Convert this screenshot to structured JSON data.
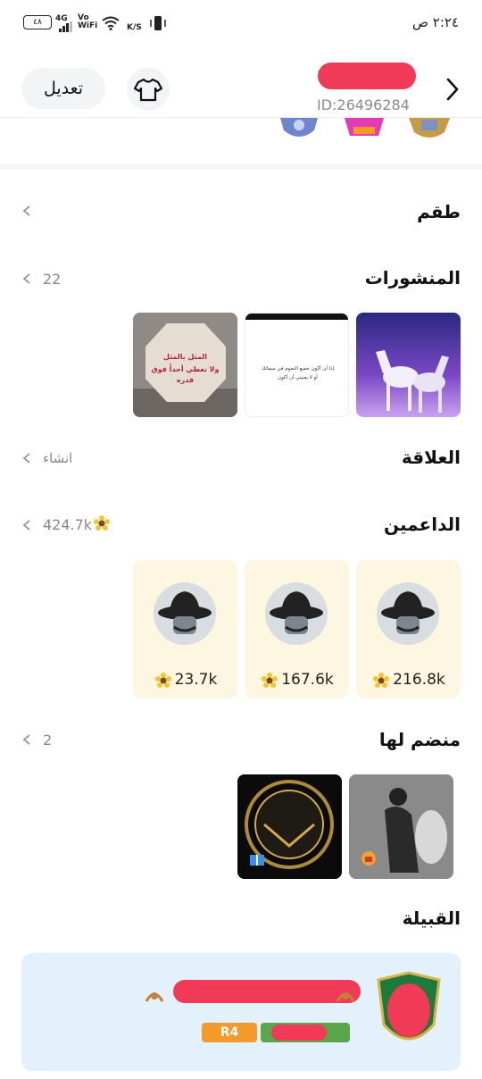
{
  "status_bar": {
    "time": "٢:٢٤ ص",
    "battery": "٤٨",
    "network": "4G",
    "vowifi": "Vo WiFi",
    "speed": "K/S"
  },
  "header": {
    "edit_label": "تعديل",
    "user_id": "ID:26496284"
  },
  "sections": {
    "outfit": {
      "title": "طقم"
    },
    "posts": {
      "title": "المنشورات",
      "count": "22"
    },
    "relationship": {
      "title": "العلاقة",
      "action": "انشاء"
    },
    "supporters": {
      "title": "الداعمين",
      "total": "424.7k",
      "items": [
        {
          "value": "216.8k"
        },
        {
          "value": "167.6k"
        },
        {
          "value": "23.7k"
        }
      ]
    },
    "joined": {
      "title": "منضم لها",
      "count": "2"
    },
    "clan": {
      "title": "القبيلة",
      "rank": "R4"
    }
  },
  "post_texts": {
    "quote_line1": "إذا أن أكون جميع النجوم في سمائك",
    "quote_line2": "أو لا يعنيني أن أكون",
    "sign_line1": "المثل بالمثل",
    "sign_line2": "ولا نعطي أحداً فوق قدره"
  },
  "colors": {
    "accent_gold": "#f3c62e",
    "card_bg": "#fdf6e1",
    "clan_bg": "#e2f1fb",
    "redaction": "#f03a57"
  },
  "icons": {
    "back": "chevron-right-icon",
    "shirt": "shirt-icon",
    "row": "chevron-left-icon",
    "sunflower": "sunflower-icon"
  }
}
